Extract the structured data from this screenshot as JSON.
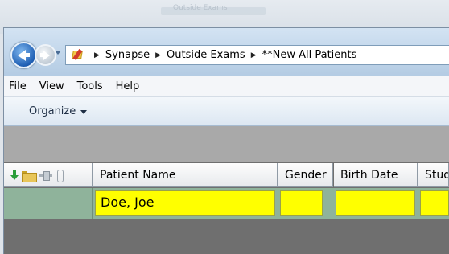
{
  "window": {
    "title": "Outside Exams"
  },
  "navigation": {
    "breadcrumbs": [
      "Synapse",
      "Outside Exams",
      "**New All Patients"
    ]
  },
  "menu": {
    "items": [
      "File",
      "View",
      "Tools",
      "Help"
    ]
  },
  "commandbar": {
    "organize_label": "Organize"
  },
  "grid": {
    "columns": [
      "Patient Name",
      "Gender",
      "Birth Date",
      "Study"
    ],
    "rows": [
      {
        "patient_name": "Doe, Joe",
        "gender": "",
        "birth_date": "",
        "study": ""
      }
    ],
    "highlight_color": "#ffff00"
  }
}
